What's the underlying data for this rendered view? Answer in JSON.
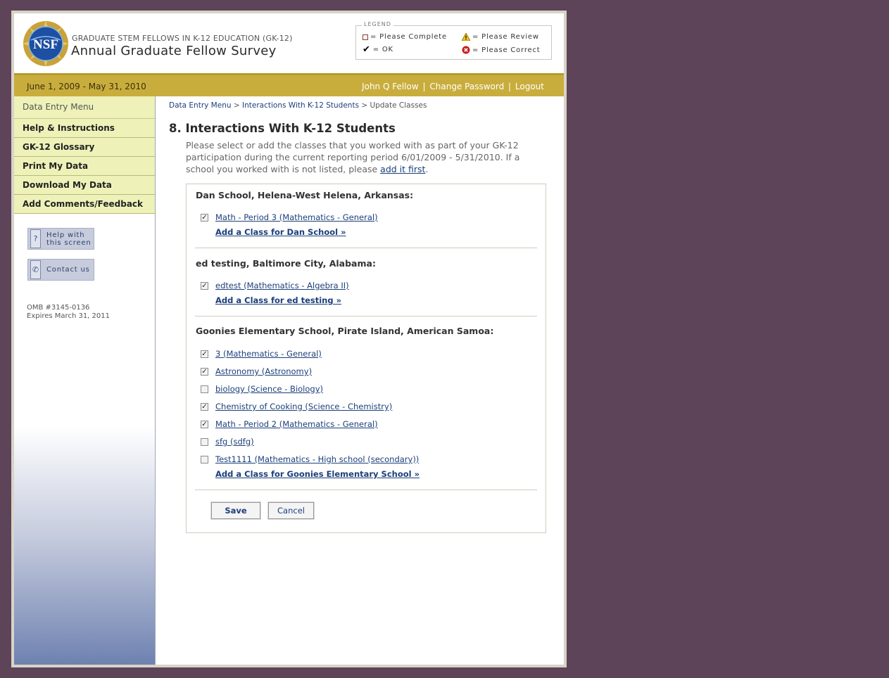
{
  "header": {
    "subtitle": "GRADUATE STEM FELLOWS IN K-12 EDUCATION (GK-12)",
    "title": "Annual Graduate Fellow Survey",
    "logo_text": "NSF"
  },
  "legend": {
    "title": "LEGEND",
    "please_complete": "= Please Complete",
    "ok": "= OK",
    "please_review": "= Please Review",
    "please_correct": "= Please Correct"
  },
  "topbar": {
    "dates": "June 1, 2009 - May 31, 2010",
    "user": "John Q Fellow",
    "change_password": "Change Password",
    "logout": "Logout",
    "separator": "|"
  },
  "sidebar": {
    "heading": "Data Entry Menu",
    "items": [
      {
        "label": "Help & Instructions"
      },
      {
        "label": "GK-12 Glossary"
      },
      {
        "label": "Print My Data"
      },
      {
        "label": "Download My Data"
      },
      {
        "label": "Add Comments/Feedback"
      }
    ],
    "help_line1": "Help with",
    "help_line2": "this screen",
    "contact": "Contact us",
    "omb_line1": "OMB #3145-0136",
    "omb_line2": "Expires March 31, 2011"
  },
  "breadcrumb": {
    "crumb1": "Data Entry Menu",
    "crumb2": "Interactions With K-12 Students",
    "current": "Update Classes",
    "sep": ">"
  },
  "main": {
    "heading": "8. Interactions With K-12 Students",
    "intro_text": "Please select or add the classes that you worked with as part of your GK-12 participation during the current reporting period 6/01/2009 - 5/31/2010. If a school you worked with is not listed, please ",
    "intro_link": "add it first",
    "intro_end": "."
  },
  "schools": [
    {
      "title": "Dan School, Helena-West Helena, Arkansas:",
      "classes": [
        {
          "label": "Math - Period 3 (Mathematics - General)",
          "checked": true
        }
      ],
      "add_link": "Add a Class for Dan School »"
    },
    {
      "title": "ed testing, Baltimore City, Alabama:",
      "classes": [
        {
          "label": "edtest (Mathematics - Algebra II)",
          "checked": true
        }
      ],
      "add_link": "Add a Class for ed testing »"
    },
    {
      "title": "Goonies Elementary School, Pirate Island, American Samoa:",
      "classes": [
        {
          "label": "3 (Mathematics - General)",
          "checked": true
        },
        {
          "label": "Astronomy (Astronomy)",
          "checked": true
        },
        {
          "label": "biology (Science - Biology)",
          "checked": false
        },
        {
          "label": "Chemistry of Cooking (Science - Chemistry)",
          "checked": true
        },
        {
          "label": "Math - Period 2 (Mathematics - General)",
          "checked": true
        },
        {
          "label": "sfg (sdfg)",
          "checked": false
        },
        {
          "label": "Test1111 (Mathematics - High school (secondary))",
          "checked": false
        }
      ],
      "add_link": "Add a Class for Goonies Elementary School »"
    }
  ],
  "buttons": {
    "save": "Save",
    "cancel": "Cancel"
  }
}
